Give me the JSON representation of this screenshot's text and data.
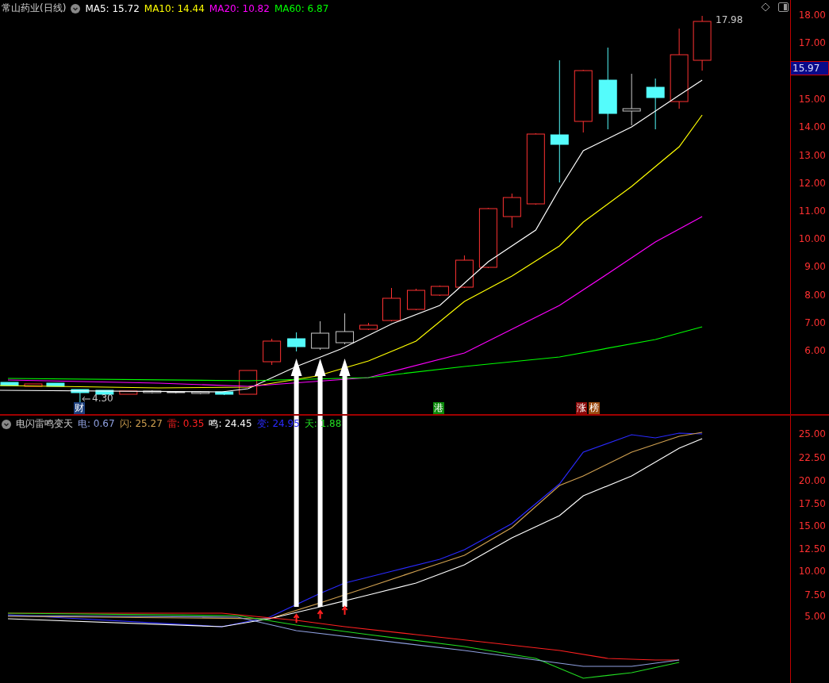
{
  "main_header": {
    "title": "常山药业(日线)",
    "values": [
      {
        "text": "MA5: 15.72",
        "color": "#ffffff"
      },
      {
        "text": "MA10: 14.44",
        "color": "#ffff00"
      },
      {
        "text": "MA20: 10.82",
        "color": "#ff00ff"
      },
      {
        "text": "MA60: 6.87",
        "color": "#00ff00"
      }
    ]
  },
  "price_axis": {
    "ticks": [
      "18.00",
      "17.00",
      "15.00",
      "14.00",
      "13.00",
      "12.00",
      "11.00",
      "10.00",
      "9.00",
      "8.00",
      "7.00",
      "6.00"
    ],
    "current_price": "15.97"
  },
  "chart_labels": {
    "high": "17.98",
    "low": "4.30"
  },
  "event_tags": [
    {
      "label": "财",
      "color": "#1c3f7c"
    },
    {
      "label": "港",
      "color": "#0a8a0a"
    },
    {
      "label": "涨",
      "color": "#8b0a0a"
    },
    {
      "label": "榜",
      "color": "#9a4a10"
    }
  ],
  "indicator_header": {
    "title": "电闪雷鸣变天",
    "values": [
      {
        "text": "电: 0.67",
        "color": "#8fa0e0"
      },
      {
        "text": "闪: 25.27",
        "color": "#d0a050"
      },
      {
        "text": "雷: 0.35",
        "color": "#ff2020"
      },
      {
        "text": "鸣: 24.45",
        "color": "#ffffff"
      },
      {
        "text": "变: 24.95",
        "color": "#2a2aff"
      },
      {
        "text": "天: 1.88",
        "color": "#22dd22"
      }
    ]
  },
  "indicator_axis": {
    "ticks": [
      "25.00",
      "22.50",
      "20.00",
      "17.50",
      "15.00",
      "12.50",
      "10.00",
      "7.50",
      "5.00"
    ]
  }
}
